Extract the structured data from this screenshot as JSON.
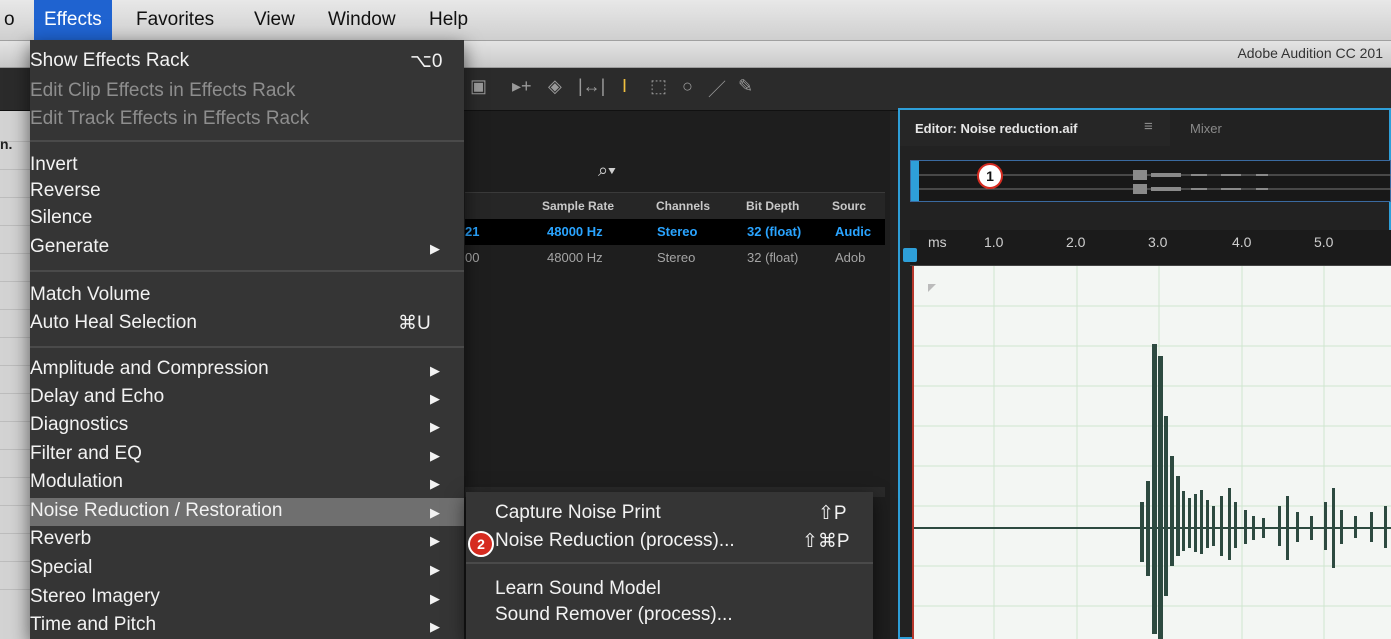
{
  "menubar": {
    "items": [
      {
        "label": "o"
      },
      {
        "label": "Effects"
      },
      {
        "label": "Favorites"
      },
      {
        "label": "View"
      },
      {
        "label": "Window"
      },
      {
        "label": "Help"
      }
    ]
  },
  "app": {
    "title": "Adobe Audition CC 201"
  },
  "files": {
    "strip_label": "n.",
    "search_icon": "search-icon",
    "columns": [
      "Sample Rate",
      "Channels",
      "Bit Depth",
      "Sourc"
    ],
    "rows": [
      {
        "frag": "21",
        "sample_rate": "48000 Hz",
        "channels": "Stereo",
        "bit_depth": "32 (float)",
        "source": "Audic"
      },
      {
        "frag": "00",
        "sample_rate": "48000 Hz",
        "channels": "Stereo",
        "bit_depth": "32 (float)",
        "source": "Adob"
      }
    ]
  },
  "editor": {
    "tab_label": "Editor: Noise reduction.aif",
    "tab_menu": "≡",
    "mixer_label": "Mixer",
    "ruler": [
      "ms",
      "1.0",
      "2.0",
      "3.0",
      "4.0",
      "5.0"
    ]
  },
  "effects_menu": {
    "show_rack": "Show Effects Rack",
    "show_rack_shortcut": "⌥0",
    "edit_clip": "Edit Clip Effects in Effects Rack",
    "edit_track": "Edit Track Effects in Effects Rack",
    "invert": "Invert",
    "reverse": "Reverse",
    "silence": "Silence",
    "generate": "Generate",
    "match_volume": "Match Volume",
    "auto_heal": "Auto Heal Selection",
    "auto_heal_shortcut": "⌘U",
    "amplitude": "Amplitude and Compression",
    "delay": "Delay and Echo",
    "diagnostics": "Diagnostics",
    "filter": "Filter and EQ",
    "modulation": "Modulation",
    "noise": "Noise Reduction / Restoration",
    "reverb": "Reverb",
    "special": "Special",
    "stereo": "Stereo Imagery",
    "time_pitch": "Time and Pitch"
  },
  "noise_submenu": {
    "capture": "Capture Noise Print",
    "capture_shortcut": "⇧P",
    "process": "Noise Reduction (process)...",
    "process_shortcut": "⇧⌘P",
    "learn": "Learn Sound Model",
    "remover": "Sound Remover (process)..."
  },
  "callouts": {
    "one": "1",
    "two": "2"
  },
  "colors": {
    "accent_blue": "#2e9fd9",
    "highlight": "#6f6f6f",
    "callout_red": "#d62b20",
    "waveform": "#2d4a40"
  }
}
